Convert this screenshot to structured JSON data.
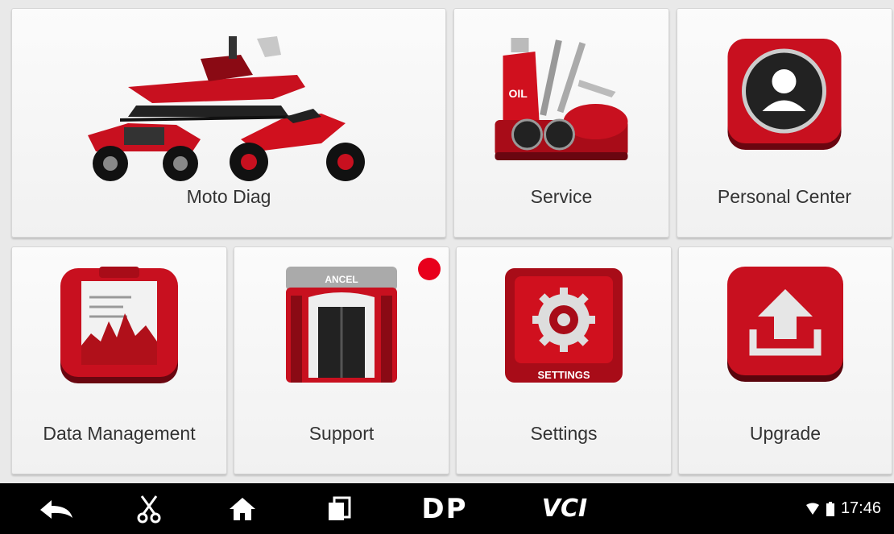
{
  "tiles": {
    "moto_diag": {
      "label": "Moto Diag"
    },
    "service": {
      "label": "Service"
    },
    "personal_center": {
      "label": "Personal Center"
    },
    "data_management": {
      "label": "Data Management"
    },
    "support": {
      "label": "Support",
      "sign": "ANCEL",
      "has_notification": true
    },
    "settings": {
      "label": "Settings",
      "sign": "SETTINGS"
    },
    "upgrade": {
      "label": "Upgrade"
    }
  },
  "service_icon": {
    "bottle_text": "OIL"
  },
  "navbar": {
    "back_icon": "back-arrow-icon",
    "screenshot_icon": "scissors-icon",
    "home_icon": "home-icon",
    "recents_icon": "recents-icon",
    "dp_text": "DP",
    "vci_text": "VCI"
  },
  "status_bar": {
    "time": "17:46",
    "wifi_icon": "wifi-icon",
    "battery_icon": "battery-icon"
  },
  "colors": {
    "accent_red": "#c8101f",
    "notification_red": "#e8001c",
    "navbar_bg": "#000000",
    "tile_bg": "#f6f6f6"
  }
}
